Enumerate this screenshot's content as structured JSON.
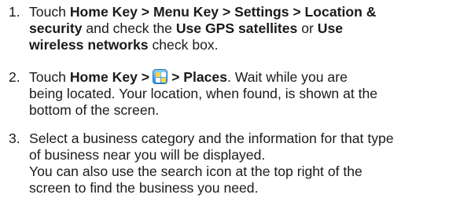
{
  "steps": [
    {
      "number": "1.",
      "l1_a": "Touch ",
      "l1_b": "Home Key > Menu Key > Settings > Location &",
      "l2_a": "security",
      "l2_b": " and check the ",
      "l2_c": "Use GPS satellites",
      "l2_d": " or ",
      "l2_e": "Use",
      "l3_a": "wireless networks",
      "l3_b": " check box."
    },
    {
      "number": "2.",
      "l1_a": "Touch ",
      "l1_b": "Home Key >",
      "l1_icon": "app-launcher-icon",
      "l1_c": "> Places",
      "l1_d": ". Wait while you are",
      "l2": "being located. Your location, when found, is shown at the",
      "l3": "bottom of the screen."
    },
    {
      "number": "3.",
      "l1": "Select a business category and the information for that type",
      "l2": "of business near you will be displayed.",
      "l3": "You can also use the search icon at the top right of the",
      "l4": "screen to find the business you need."
    }
  ]
}
